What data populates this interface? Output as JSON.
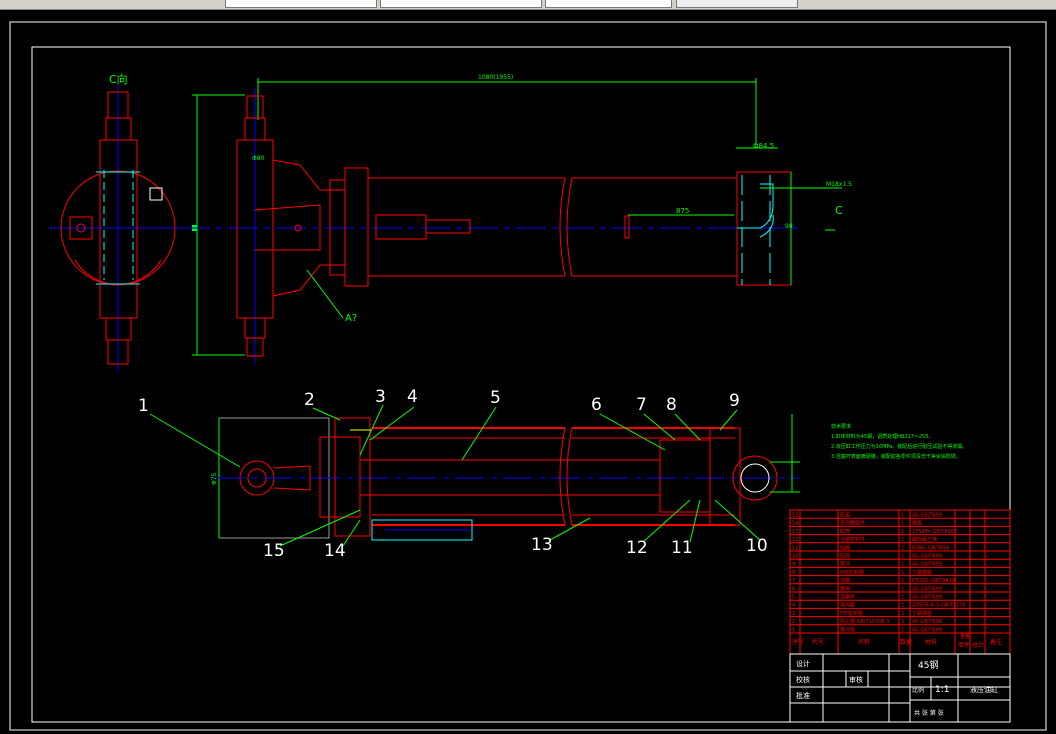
{
  "toolbar": {
    "fields": [
      "",
      "",
      "",
      ""
    ]
  },
  "colors": {
    "background": "#000000",
    "outline": "#ff0000",
    "dimension": "#00ff00",
    "centerline": "#0000ff",
    "hidden": "#00ffff",
    "frame": "#ffffff"
  },
  "top_view": {
    "view_label": "C向",
    "section_label": "A?",
    "arrow_label": "C",
    "overall_dim": "Φ80",
    "end_dim": "Φ84.5",
    "stroke_dim": "875",
    "port_dim": "M18x1.5",
    "height_dim": "98",
    "length_dim": "1080(1955)"
  },
  "section_view": {
    "part_numbers": [
      "1",
      "2",
      "3",
      "4",
      "5",
      "6",
      "7",
      "8",
      "9",
      "10",
      "11",
      "12",
      "13",
      "14",
      "15"
    ],
    "dim_left": "Φ75"
  },
  "notes": {
    "title": "技术要求",
    "lines": [
      "1.缸体材料为45钢，调质处理HB217～255。",
      "2.液压缸工作压力为16MPa，装配后进行耐压试验不得渗漏。",
      "3.活塞杆表面镀硬铬，装配前各零件须清洗干净涂油防锈。"
    ]
  },
  "parts_table": {
    "headers": [
      "序号",
      "代号",
      "名称",
      "数量",
      "材料",
      "单件",
      "总计",
      "备注"
    ],
    "weight_header": "重量",
    "rows": [
      {
        "no": "15",
        "name": "缸盖",
        "qty": "1",
        "material": "45-GB/T699"
      },
      {
        "no": "14",
        "name": "密封圈组件",
        "qty": "1",
        "material": "橡胶"
      },
      {
        "no": "13",
        "name": "缸筒",
        "qty": "1",
        "material": "27SiMn-GB/T8162"
      },
      {
        "no": "12",
        "name": "活塞密封件",
        "qty": "1",
        "material": "聚四氟乙烯"
      },
      {
        "no": "11",
        "name": "挡圈",
        "qty": "1",
        "material": "65Mn-GB/T699"
      },
      {
        "no": "10",
        "name": "缸底",
        "qty": "1",
        "material": "45-GB/T699"
      },
      {
        "no": "9",
        "name": "耳环",
        "qty": "1",
        "material": "45-GB/T699"
      },
      {
        "no": "8",
        "name": "O形密封圈",
        "qty": "1",
        "material": "丁腈橡胶"
      },
      {
        "no": "7",
        "name": "活塞",
        "qty": "1",
        "material": "HT200-GB/T9439"
      },
      {
        "no": "6",
        "name": "螺母",
        "qty": "1",
        "material": "45-GB/T699"
      },
      {
        "no": "5",
        "name": "活塞杆",
        "qty": "1",
        "material": "45-GB/T699"
      },
      {
        "no": "4",
        "name": "导向套",
        "qty": "1",
        "material": "ZQSn6-6-3-GB/T1176"
      },
      {
        "no": "3",
        "name": "Y形密封圈",
        "qty": "1",
        "material": "丁腈橡胶"
      },
      {
        "no": "2",
        "name": "防尘圈 GB/T10708.3",
        "qty": "1",
        "material": "45-GB/T699"
      },
      {
        "no": "1",
        "name": "耳环销",
        "qty": "1",
        "material": "45-GB/T699"
      }
    ]
  },
  "title_block": {
    "design": "设计",
    "check": "校核",
    "review": "审核",
    "approve": "批准",
    "material": "45钢",
    "scale_label": "比例",
    "scale": "1:1",
    "drawing_name": "液压油缸",
    "sheet": "共 张 第 张"
  }
}
